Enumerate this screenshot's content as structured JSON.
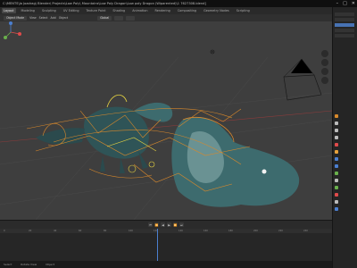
{
  "window": {
    "title": "C:\\MENTS\\Ja Joadrag\\ Blender\\ Projects\\Low Poly\\ Mountains\\Low Poly Dragon\\Low poly Dragon (Wiparented)\\1 7627308.blend]",
    "controls": [
      "–",
      "□",
      "✕"
    ]
  },
  "menubar": {
    "tabs": [
      "Layout",
      "Modeling",
      "Sculpting",
      "UV Editing",
      "Texture Paint",
      "Shading",
      "Animation",
      "Rendering",
      "Compositing",
      "Geometry Nodes",
      "Scripting"
    ],
    "active_index": 0
  },
  "header": {
    "mode": "Object Mode",
    "view": "View",
    "select": "Select",
    "add": "Add",
    "object": "Object",
    "transform": "Global"
  },
  "timeline": {
    "ticks": [
      "0",
      "20",
      "40",
      "60",
      "80",
      "100",
      "120",
      "140",
      "160",
      "180",
      "200",
      "220",
      "240"
    ],
    "playback_icons": [
      "⏮",
      "⏪",
      "◀",
      "▶",
      "⏩",
      "⏭"
    ]
  },
  "status": {
    "left": "Select",
    "middle": "Rotate View",
    "right": "Object"
  },
  "colors": {
    "viewport_bg": "#3e3e3e",
    "rig_orange": "#d9892b",
    "dragon_teal": "#3d6b6e",
    "selection_yellow": "#e6d442",
    "accent_blue": "#4772b3"
  }
}
